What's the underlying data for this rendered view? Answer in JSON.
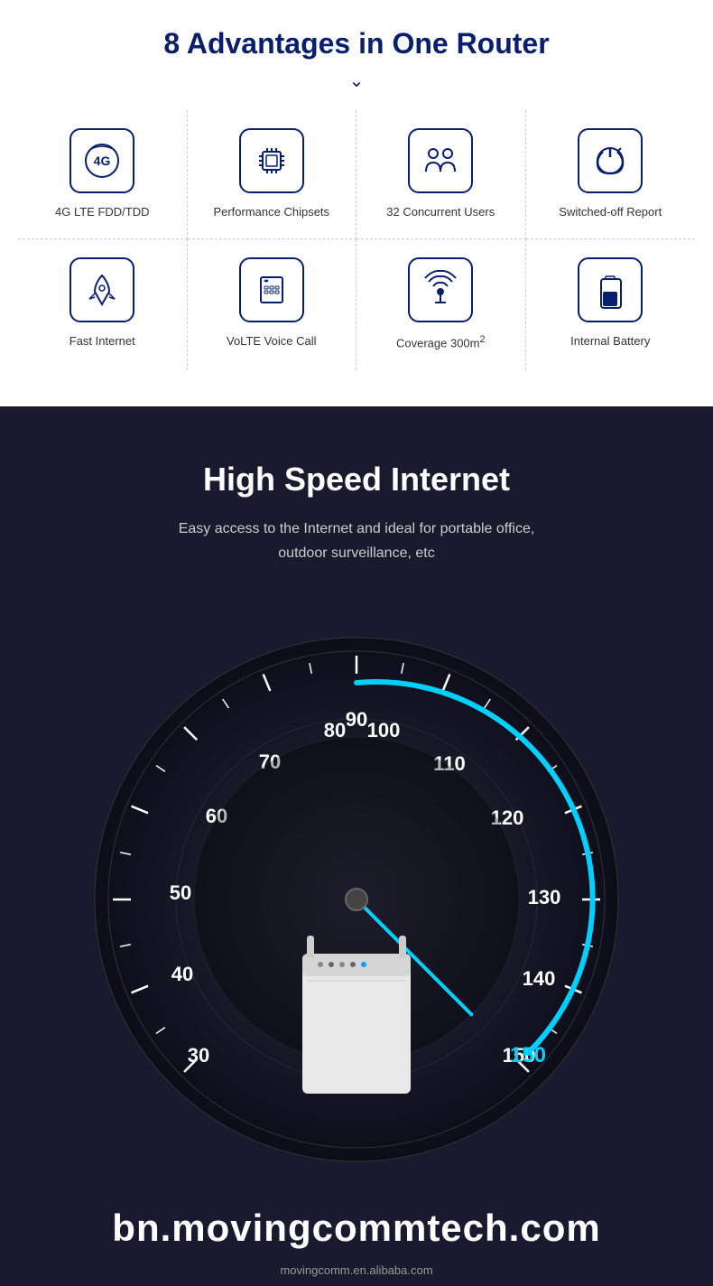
{
  "advantages": {
    "title": "8 Advantages in One Router",
    "items": [
      {
        "id": "4g-lte",
        "label": "4G LTE FDD/TDD",
        "icon": "4g"
      },
      {
        "id": "chipset",
        "label": "Performance Chipsets",
        "icon": "chip"
      },
      {
        "id": "users",
        "label": "32 Concurrent Users",
        "icon": "users"
      },
      {
        "id": "switchoff",
        "label": "Switched-off Report",
        "icon": "power"
      },
      {
        "id": "fast",
        "label": "Fast Internet",
        "icon": "rocket"
      },
      {
        "id": "volte",
        "label": "VoLTE Voice Call",
        "icon": "phone"
      },
      {
        "id": "coverage",
        "label": "Coverage 300m²",
        "icon": "wifi"
      },
      {
        "id": "battery",
        "label": "Internal Battery",
        "icon": "battery"
      }
    ]
  },
  "highspeed": {
    "title": "High Speed Internet",
    "description_line1": "Easy access to the Internet and ideal for portable office,",
    "description_line2": "outdoor surveillance, etc",
    "speedometer_labels": [
      "30",
      "40",
      "50",
      "60",
      "70",
      "80",
      "90",
      "100",
      "110",
      "120",
      "130",
      "140",
      "150"
    ],
    "needle_value": 150
  },
  "footer": {
    "website": "bn.movingcommtech.com",
    "alibaba": "movingcomm.en.alibaba.com"
  }
}
